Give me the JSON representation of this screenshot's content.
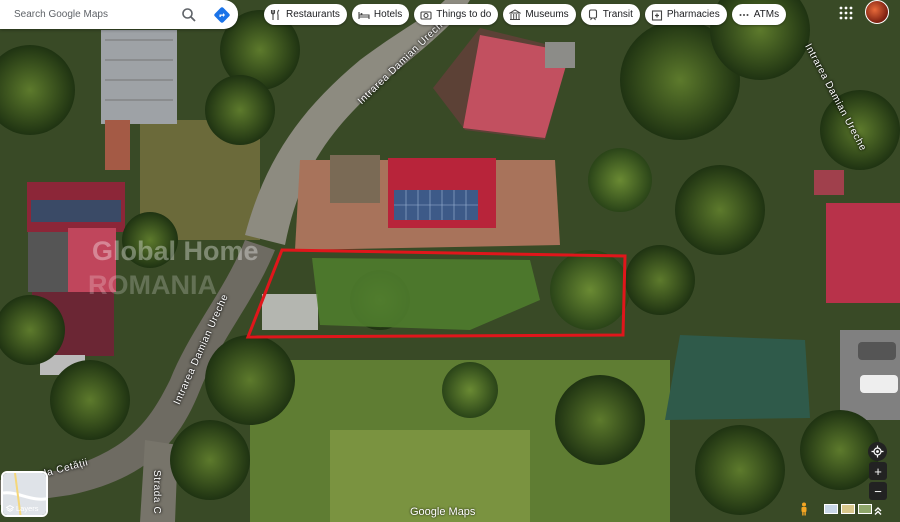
{
  "search": {
    "placeholder": "Search Google Maps"
  },
  "categories": [
    {
      "label": "Restaurants",
      "icon": "fork-knife-icon"
    },
    {
      "label": "Hotels",
      "icon": "bed-icon"
    },
    {
      "label": "Things to do",
      "icon": "camera-icon"
    },
    {
      "label": "Museums",
      "icon": "museum-icon"
    },
    {
      "label": "Transit",
      "icon": "train-icon"
    },
    {
      "label": "Pharmacies",
      "icon": "pharmacy-icon"
    },
    {
      "label": "ATMs",
      "icon": "more-dots-icon"
    }
  ],
  "streets": {
    "top_road": "Intrarea Damian Ureche",
    "right_road": "Intrarea Damian Ureche",
    "left_road": "Intrarea Damian Ureche",
    "bottom_left": "Strada Cetății",
    "bottom_vertical": "Strada C"
  },
  "watermark": {
    "line1": "Global Home",
    "line2": "ROMANIA"
  },
  "layers": {
    "label": "Layers"
  },
  "logo": {
    "text": "Google Maps"
  },
  "colors": {
    "plot_outline": "#e0161b",
    "roof_red": "#b8243a"
  }
}
